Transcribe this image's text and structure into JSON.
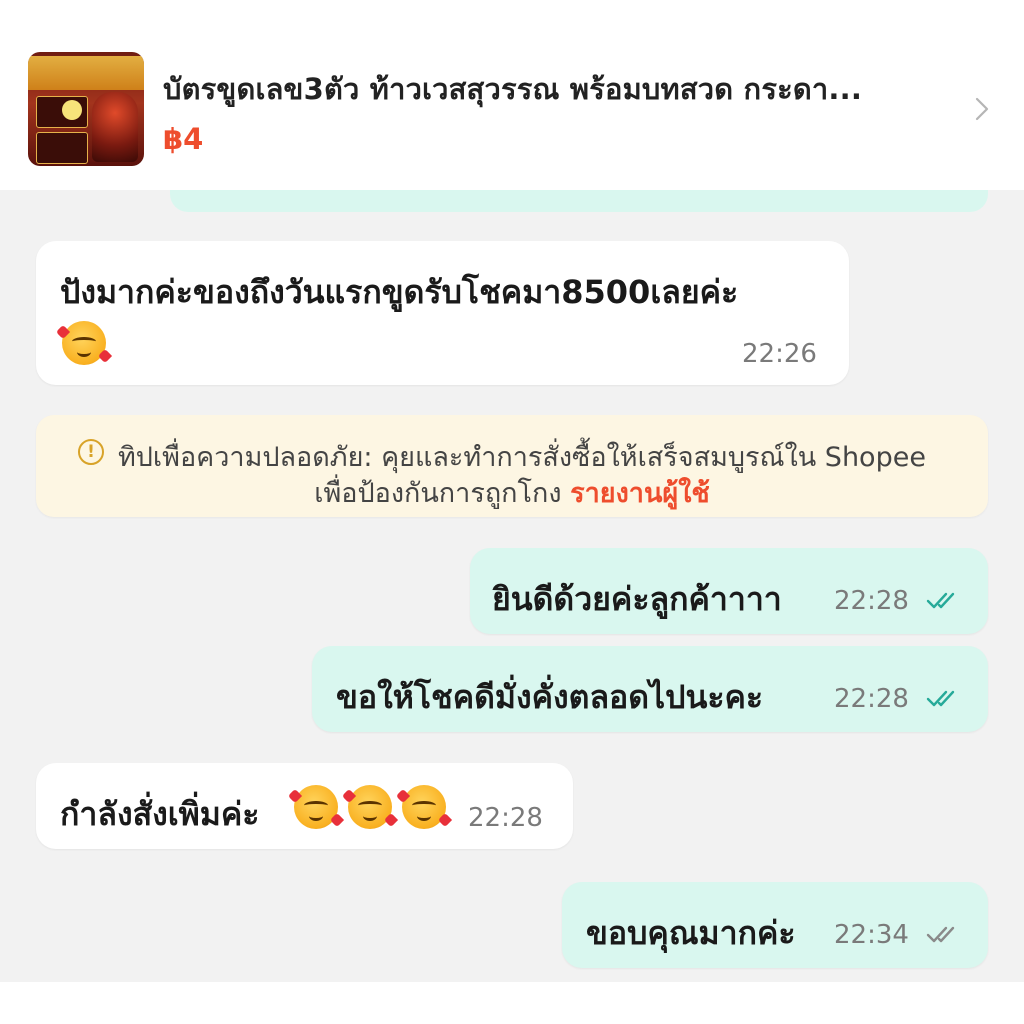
{
  "product": {
    "title": "บัตรขูดเลข3ตัว ท้าวเวสสุวรรณ พร้อมบทสวด กระดา...",
    "price": "฿4",
    "thumbnail_icon": "product-thumbnail",
    "chevron_icon": "chevron-right-icon"
  },
  "messages": [
    {
      "side": "in",
      "text": "ปังมากค่ะของถึงวันแรกขูดรับโชคมา8500เลยค่ะ",
      "emoji": "smiling-face-with-hearts",
      "time": "22:26"
    },
    {
      "side": "out",
      "text": "ยินดีด้วยค่ะลูกค้าาาา",
      "time": "22:28",
      "status": "read"
    },
    {
      "side": "out",
      "text": "ขอให้โชคดีมั่งคั่งตลอดไปนะคะ",
      "time": "22:28",
      "status": "read"
    },
    {
      "side": "in",
      "text": "กำลังสั่งเพิ่มค่ะ",
      "emoji": "smiling-face-with-hearts",
      "time": "22:28"
    },
    {
      "side": "out",
      "text": "ขอบคุณมากค่ะ",
      "time": "22:34",
      "status": "delivered"
    }
  ],
  "tip": {
    "line1": "ทิปเพื่อความปลอดภัย: คุยและทำการสั่งซื้อให้เสร็จสมบูรณ์ใน Shopee",
    "line2": "เพื่อป้องกันการถูกโกง",
    "link": "รายงานผู้ใช้"
  },
  "colors": {
    "accent": "#ee4d2d",
    "out_bubble": "#d9f7ef",
    "in_bubble": "#ffffff",
    "read_tick": "#26aa99",
    "tip_bg": "#fdf6e3"
  }
}
